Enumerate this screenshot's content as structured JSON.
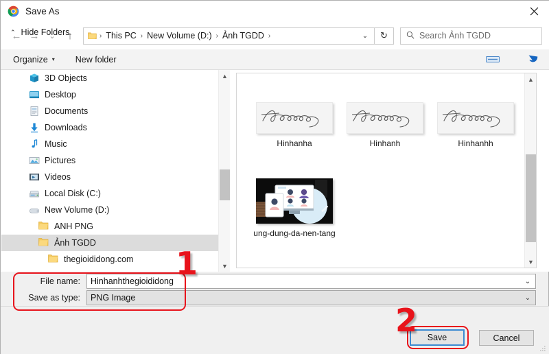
{
  "window": {
    "title": "Save As",
    "app_icon": "chrome-icon",
    "close_label": "✕"
  },
  "nav": {
    "back": "←",
    "forward": "→",
    "recent": "⌄",
    "up": "↑",
    "refresh": "↻",
    "dropdown": "⌄",
    "breadcrumbs": [
      "This PC",
      "New Volume (D:)",
      "Ảnh TGDD"
    ],
    "separator": "›"
  },
  "search": {
    "placeholder": "Search Ảnh TGDD",
    "icon": "search-icon",
    "value": ""
  },
  "toolbar": {
    "organize": "Organize",
    "new_folder": "New folder",
    "caret": "▾",
    "view_icon": "view-layout-icon",
    "help_icon": "help-arrow-icon"
  },
  "tree": {
    "items": [
      {
        "label": "3D Objects",
        "icon": "3d-objects-icon",
        "indent": 0,
        "selected": false
      },
      {
        "label": "Desktop",
        "icon": "desktop-icon",
        "indent": 0,
        "selected": false
      },
      {
        "label": "Documents",
        "icon": "documents-icon",
        "indent": 0,
        "selected": false
      },
      {
        "label": "Downloads",
        "icon": "downloads-icon",
        "indent": 0,
        "selected": false
      },
      {
        "label": "Music",
        "icon": "music-icon",
        "indent": 0,
        "selected": false
      },
      {
        "label": "Pictures",
        "icon": "pictures-icon",
        "indent": 0,
        "selected": false
      },
      {
        "label": "Videos",
        "icon": "videos-icon",
        "indent": 0,
        "selected": false
      },
      {
        "label": "Local Disk (C:)",
        "icon": "local-disk-icon",
        "indent": 0,
        "selected": false
      },
      {
        "label": "New Volume (D:)",
        "icon": "drive-icon",
        "indent": 0,
        "selected": false
      },
      {
        "label": "ANH PNG",
        "icon": "folder-icon",
        "indent": 1,
        "selected": false
      },
      {
        "label": "Ảnh TGDD",
        "icon": "folder-icon",
        "indent": 1,
        "selected": true
      },
      {
        "label": "thegioididong.com",
        "icon": "folder-icon",
        "indent": 2,
        "selected": false
      }
    ]
  },
  "files": {
    "items": [
      {
        "label": "Hinhanha",
        "thumb": "signature"
      },
      {
        "label": "Hinhanh",
        "thumb": "signature"
      },
      {
        "label": "Hinhanhh",
        "thumb": "signature"
      },
      {
        "label": "ung-dung-da-nen-tang",
        "thumb": "photo"
      }
    ],
    "signature_text": "thegioididong"
  },
  "fields": {
    "filename_label": "File name:",
    "filename_value": "Hinhanhthegioididong",
    "filetype_label": "Save as type:",
    "filetype_value": "PNG Image",
    "dropdown_caret": "⌄"
  },
  "footer": {
    "hide_folders": "Hide Folders",
    "hide_caret": "⌃",
    "save_label": "Save",
    "cancel_label": "Cancel"
  },
  "annotations": {
    "step1": "1",
    "step2": "2",
    "color": "#e8131b"
  },
  "colors": {
    "accent_blue": "#3b8ad1",
    "dialog_bg": "#f0f0f0",
    "toolbar_bg": "#f3f3f3",
    "selection": "#dcdcdc",
    "annotation_red": "#e8131b"
  }
}
